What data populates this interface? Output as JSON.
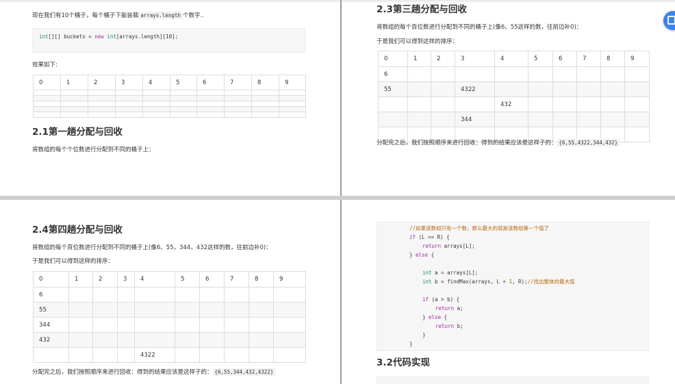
{
  "tl": {
    "intro_before": "现在我们有10个桶子，每个桶子下能装载",
    "intro_code": "arrays.length",
    "intro_after": "个数字..",
    "effect_label": "效果如下:",
    "section_title": "2.1第一趟分配与回收",
    "section_desc": "将数组的每个个位数进行分配到不同的桶子上："
  },
  "tr": {
    "section_title": "2.3第三趟分配与回收",
    "desc1": "将数组的每个百位数进行分配到不同的桶子上(像6、55这样的数，往前边补0)：",
    "desc2": "于是我们可以得到这样的排序：",
    "result_text": "分配完之后，我们按照顺序来进行回收：得到的结果应该是这样子的：",
    "result_code": "{6,55,4322,344,432}"
  },
  "bl": {
    "section_title": "2.4第四趟分配与回收",
    "desc1": "将数组的每个百位数进行分配到不同的桶子上(像6、55，344，432这样的数，往前边补0)：",
    "desc2": "于是我们可以得到这样的排序：",
    "result_text": "分配完之后，我们按照顺序来进行回收：得到的结果应该是这样子的：",
    "result_code": "{6,55,344,432,4322}"
  },
  "br": {
    "section_title": "3.2代码实现"
  },
  "tables": {
    "t1": {
      "header": [
        "0",
        "1",
        "2",
        "3",
        "4",
        "5",
        "6",
        "7",
        "8",
        "9"
      ],
      "rows": [
        [
          "",
          "",
          "",
          "",
          "",
          "",
          "",
          "",
          "",
          ""
        ],
        [
          "",
          "",
          "",
          "",
          "",
          "",
          "",
          "",
          "",
          ""
        ],
        [
          "",
          "",
          "",
          "",
          "",
          "",
          "",
          "",
          "",
          ""
        ],
        [
          "",
          "",
          "",
          "",
          "",
          "",
          "",
          "",
          "",
          ""
        ],
        [
          "",
          "",
          "",
          "",
          "",
          "",
          "",
          "",
          "",
          ""
        ]
      ]
    },
    "t2": {
      "header": [
        "0",
        "1",
        "2",
        "3",
        "4",
        "5",
        "6",
        "7",
        "8",
        "9"
      ],
      "rows": [
        [
          "6",
          "",
          "",
          "",
          "",
          "",
          "",
          "",
          "",
          ""
        ],
        [
          "55",
          "",
          "",
          "4322",
          "",
          "",
          "",
          "",
          "",
          ""
        ],
        [
          "",
          "",
          "",
          "",
          "432",
          "",
          "",
          "",
          "",
          ""
        ],
        [
          "",
          "",
          "",
          "344",
          "",
          "",
          "",
          "",
          "",
          ""
        ],
        [
          "",
          "",
          "",
          "",
          "",
          "",
          "",
          "",
          "",
          ""
        ]
      ]
    },
    "t3": {
      "header": [
        "0",
        "1",
        "2",
        "3",
        "4",
        "5",
        "6",
        "7",
        "8",
        "9"
      ],
      "rows": [
        [
          "6",
          "",
          "",
          "",
          "",
          "",
          "",
          "",
          "",
          ""
        ],
        [
          "55",
          "",
          "",
          "",
          "",
          "",
          "",
          "",
          "",
          ""
        ],
        [
          "344",
          "",
          "",
          "",
          "",
          "",
          "",
          "",
          "",
          ""
        ],
        [
          "432",
          "",
          "",
          "",
          "",
          "",
          "",
          "",
          "",
          ""
        ],
        [
          "",
          "",
          "",
          "",
          "4322",
          "",
          "",
          "",
          "",
          ""
        ]
      ]
    }
  },
  "code1": {
    "t_int": "int",
    "t_brk": "[][] buckets = ",
    "k_new": "new",
    "sp": " ",
    "t_int2": "int",
    "rest": "[arrays.length][10];"
  },
  "code2": {
    "l1": "//如果该数组只有一个数，那么最大的就是该数组第一个值了",
    "l2a": "if",
    "l2b": " (L == R) {",
    "l3a": "return",
    "l3b": " arrays[L];",
    "l4a": "} ",
    "l4b": "else",
    "l4c": " {",
    "l5a": "int",
    "l5b": " a = arrays[L];",
    "l6a": "int",
    "l6b": " b = findMax(arrays, L + ",
    "l6c": "1",
    "l6d": ", R);",
    "l6e": "//找出整体的最大值",
    "l7a": "if",
    "l7b": " (a > b) {",
    "l8a": "return",
    "l8b": " a;",
    "l9a": "} ",
    "l9b": "else",
    "l9c": " {",
    "l10a": "return",
    "l10b": " b;",
    "l11": "}",
    "l12": "}"
  }
}
